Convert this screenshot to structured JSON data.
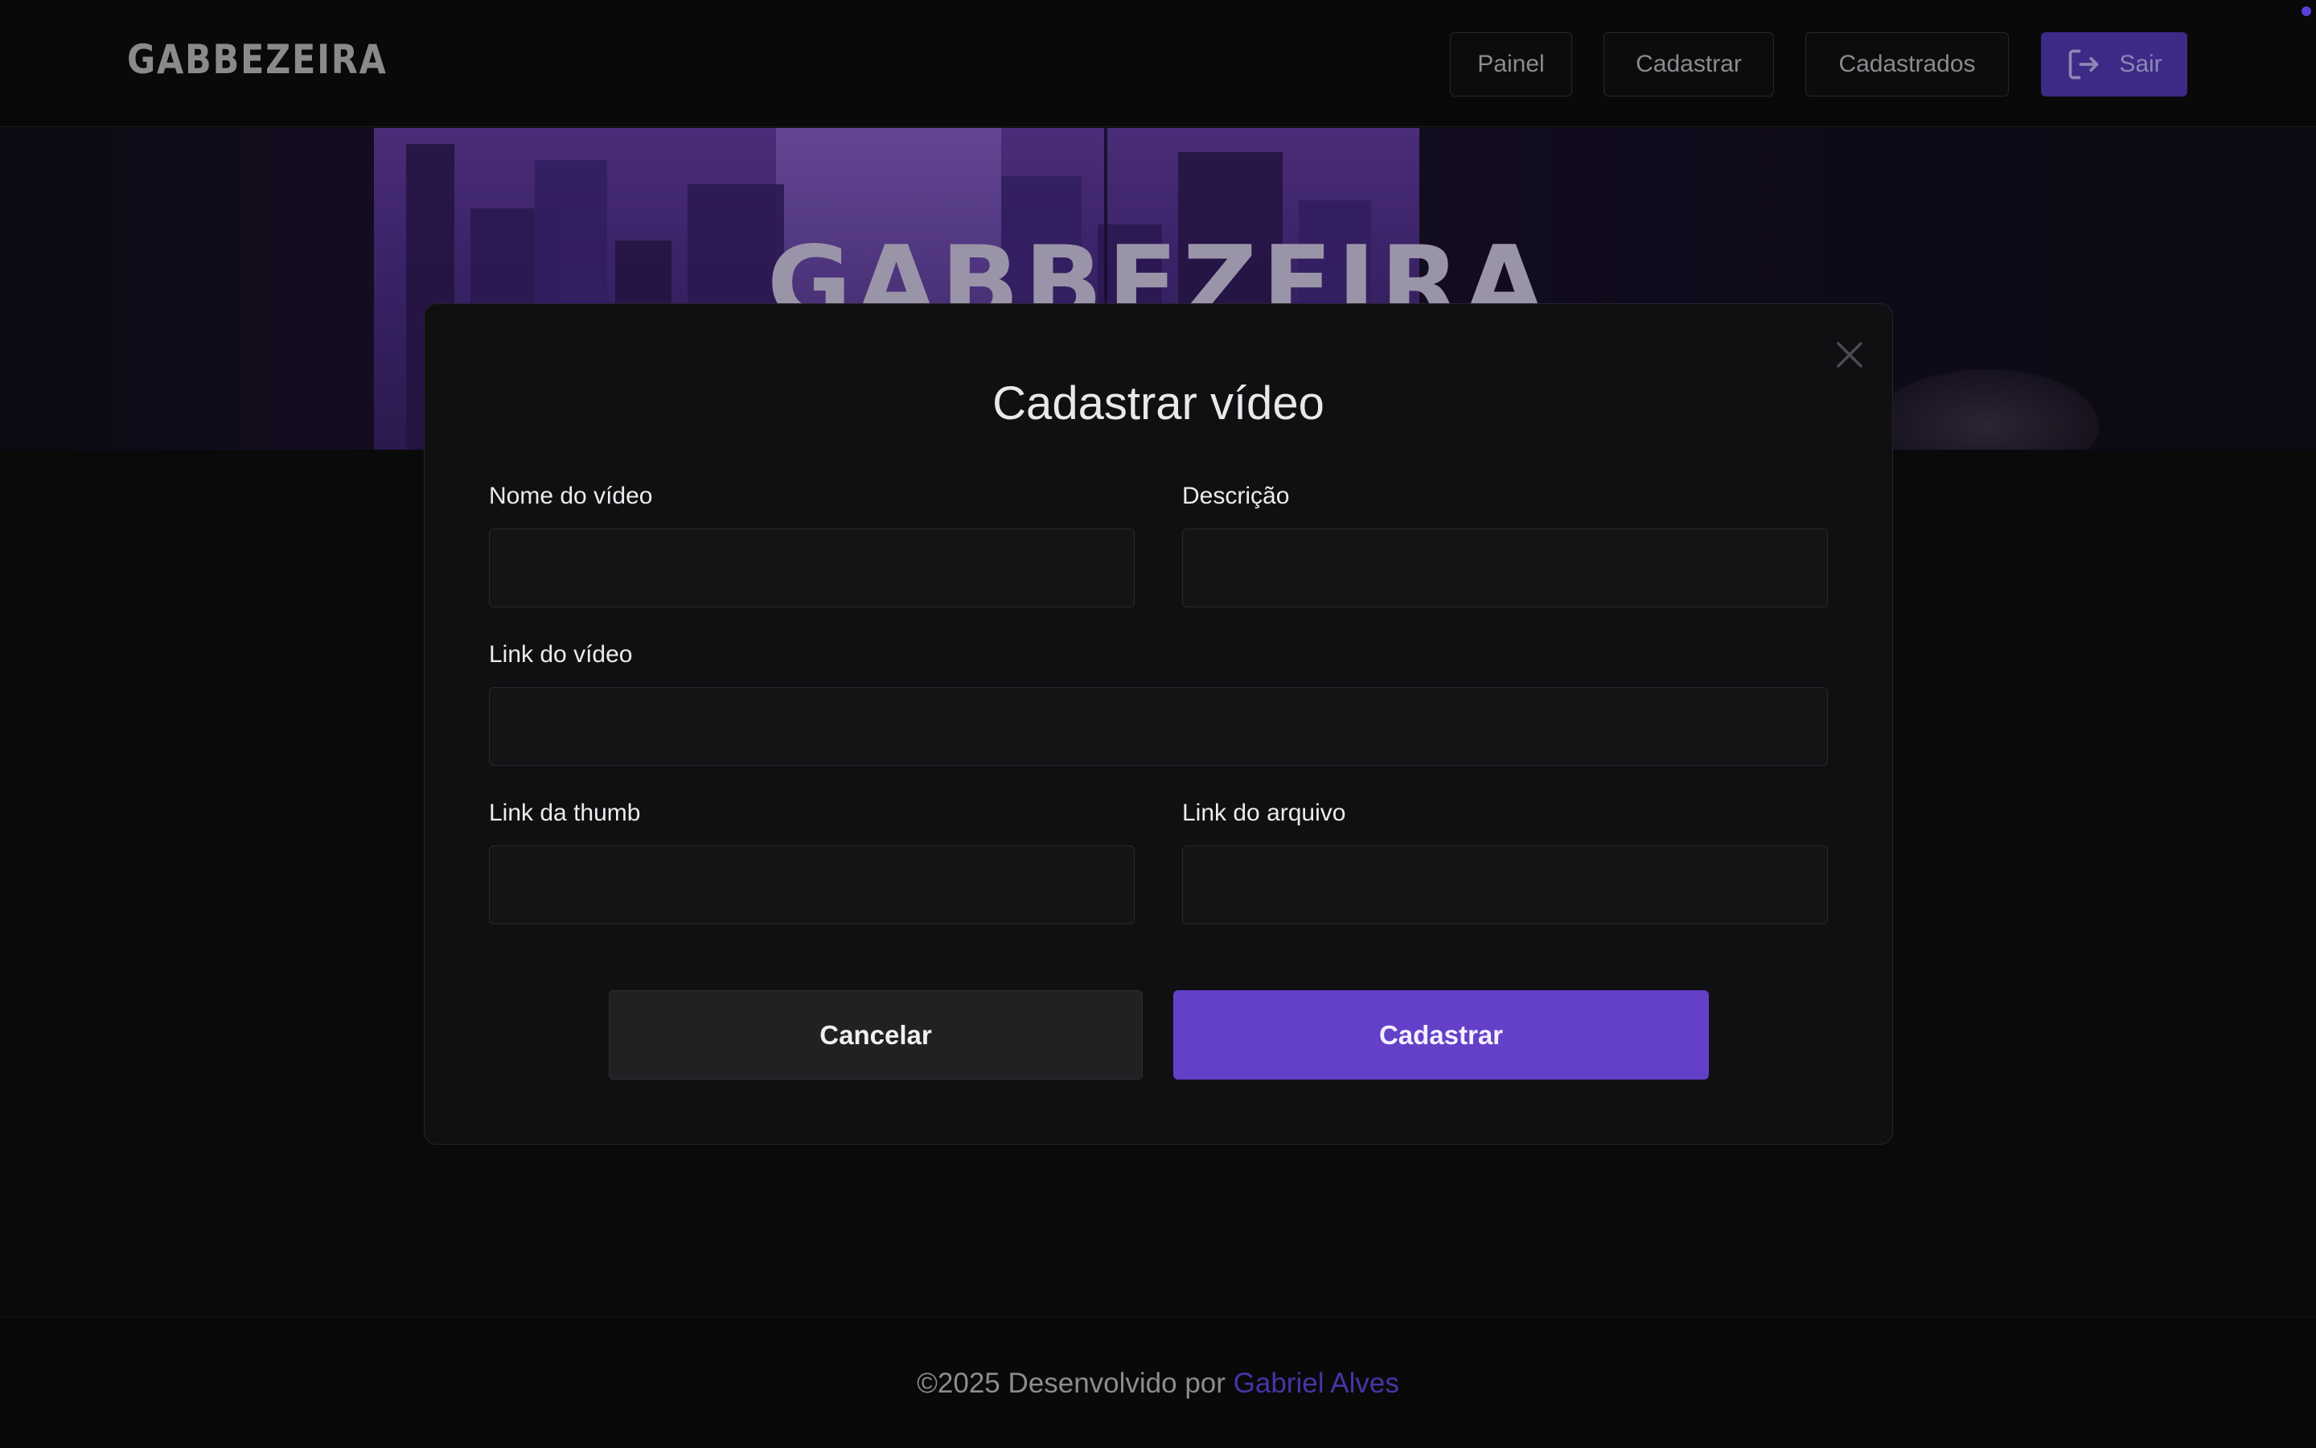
{
  "header": {
    "logo": "GABBEZEIRA",
    "nav": {
      "painel": "Painel",
      "cadastrar": "Cadastrar",
      "cadastrados": "Cadastrados",
      "sair": "Sair"
    },
    "sair_icon": "logout-icon"
  },
  "banner": {
    "title": "GABBEZEIRA"
  },
  "modal": {
    "title": "Cadastrar vídeo",
    "close_icon": "close-icon",
    "fields": {
      "nome": {
        "label": "Nome do vídeo",
        "value": ""
      },
      "descricao": {
        "label": "Descrição",
        "value": ""
      },
      "link_video": {
        "label": "Link do vídeo",
        "value": ""
      },
      "link_thumb": {
        "label": "Link da thumb",
        "value": ""
      },
      "link_arquivo": {
        "label": "Link do arquivo",
        "value": ""
      }
    },
    "cancel_label": "Cancelar",
    "submit_label": "Cadastrar"
  },
  "footer": {
    "prefix": "©2025 Desenvolvido por",
    "author": "Gabriel Alves"
  },
  "colors": {
    "accent": "#6440c8",
    "background": "#0a0a0b",
    "modal": "#101012"
  }
}
